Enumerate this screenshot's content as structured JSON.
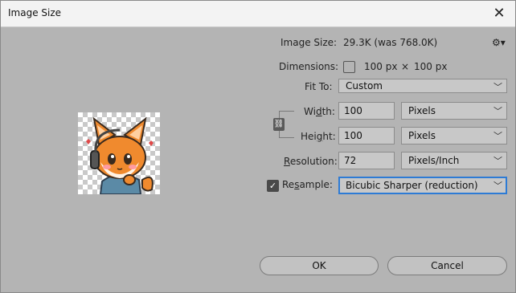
{
  "window": {
    "title": "Image Size",
    "close_glyph": "✕"
  },
  "image_size": {
    "label": "Image Size:",
    "value": "29.3K (was 768.0K)"
  },
  "settings_icon": "gear-icon",
  "dimensions": {
    "label": "Dimensions:",
    "width": "100 px",
    "times": "×",
    "height": "100 px"
  },
  "fit_to": {
    "label": "Fit To:",
    "value": "Custom"
  },
  "width": {
    "label_pre": "Wi",
    "label_ul": "d",
    "label_post": "th:",
    "value": "100",
    "unit": "Pixels"
  },
  "height": {
    "label_pre": "Hei",
    "label_ul": "g",
    "label_post": "ht:",
    "value": "100",
    "unit": "Pixels"
  },
  "resolution": {
    "label_ul": "R",
    "label_post": "esolution:",
    "value": "72",
    "unit": "Pixels/Inch"
  },
  "resample": {
    "label_pre": "Re",
    "label_ul": "s",
    "label_post": "ample:",
    "checked": true,
    "value": "Bicubic Sharper (reduction)"
  },
  "buttons": {
    "ok": "OK",
    "cancel": "Cancel"
  }
}
